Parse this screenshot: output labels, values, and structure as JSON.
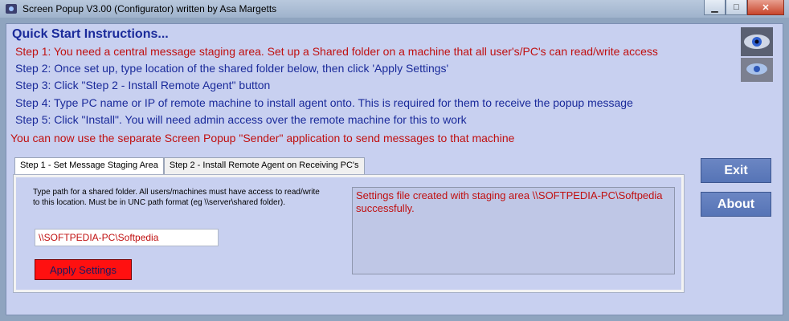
{
  "window": {
    "title": "Screen Popup V3.00 (Configurator) written by Asa Margetts",
    "minimize": "▁",
    "maximize": "□",
    "close": "✕"
  },
  "quick_start": {
    "heading": "Quick Start Instructions...",
    "steps": [
      "Step 1: You need a central message staging area.  Set up a Shared folder on a machine that all user's/PC's can read/write access",
      "Step 2: Once set up, type location of the shared folder below, then click 'Apply Settings'",
      "Step 3: Click \"Step 2 - Install Remote Agent\" button",
      "Step 4: Type PC name or IP of remote machine to install agent onto.  This is required for them to receive the popup message",
      "Step 5: Click \"Install\".  You will need admin access over the remote machine for this to work"
    ],
    "note": "You can now use the separate Screen Popup \"Sender\" application to send messages to that machine"
  },
  "tabs": [
    {
      "label": "Step 1 - Set Message Staging Area",
      "active": true
    },
    {
      "label": "Step 2 - Install Remote Agent on Receiving PC's",
      "active": false
    }
  ],
  "staging": {
    "instructions": "Type path for a shared folder.  All users/machines must have access to read/write to this location.  Must be in UNC path format (eg \\\\server\\shared folder).",
    "path_value": "\\\\SOFTPEDIA-PC\\Softpedia",
    "apply_label": "Apply Settings",
    "status_text": "Settings file created with staging area \\\\SOFTPEDIA-PC\\Softpedia successfully."
  },
  "buttons": {
    "exit": "Exit",
    "about": "About"
  },
  "colors": {
    "client_bg": "#c8d0f0",
    "instruction_blue": "#1a2a9a",
    "instruction_red": "#c01010",
    "apply_red": "#ff1010",
    "side_button": "#5f7cbc"
  }
}
